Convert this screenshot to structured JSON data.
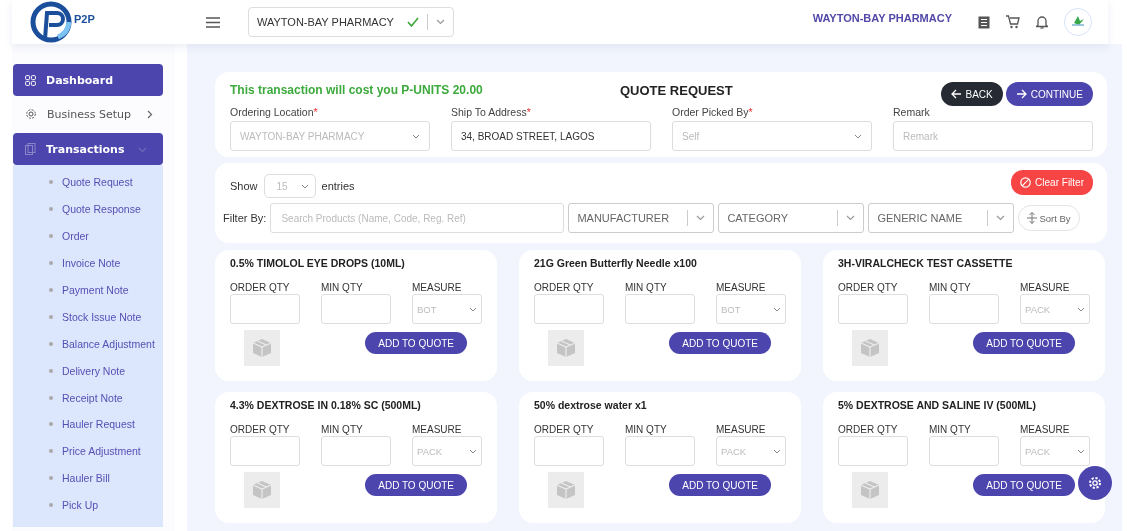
{
  "header": {
    "logo": "P2P",
    "location_select": {
      "value": "WAYTON-BAY PHARMACY",
      "valid": true
    },
    "organization": "WAYTON-BAY PHARMACY"
  },
  "sidebar": {
    "items": [
      {
        "label": "Dashboard",
        "kind": "link",
        "selected": true,
        "expanded": false
      },
      {
        "label": "Business Setup",
        "kind": "group",
        "selected": false,
        "expanded": false
      },
      {
        "label": "Transactions",
        "kind": "group",
        "selected": true,
        "expanded": true,
        "children": [
          {
            "label": "Quote Request",
            "selected": false
          },
          {
            "label": "Quote Response",
            "selected": false
          },
          {
            "label": "Order",
            "selected": false
          },
          {
            "label": "Invoice Note",
            "selected": false
          },
          {
            "label": "Payment Note",
            "selected": false
          },
          {
            "label": "Stock Issue Note",
            "selected": false
          },
          {
            "label": "Balance Adjustment",
            "selected": false
          },
          {
            "label": "Delivery Note",
            "selected": false
          },
          {
            "label": "Receipt Note",
            "selected": false
          },
          {
            "label": "Hauler Request",
            "selected": false
          },
          {
            "label": "Price Adjustment",
            "selected": false
          },
          {
            "label": "Hauler Bill",
            "selected": false
          },
          {
            "label": "Pick Up",
            "selected": false
          }
        ]
      }
    ]
  },
  "quote": {
    "cost_notice": "This transaction will cost you P-UNITS 20.00",
    "title": "QUOTE REQUEST",
    "back_button": "BACK",
    "continue_button": "CONTINUE",
    "fields": [
      {
        "label": "Ordering Location",
        "required_mark": "*",
        "kind": "select",
        "value": "WAYTON-BAY PHARMACY",
        "disabled": true
      },
      {
        "label": "Ship To Address",
        "required_mark": "*",
        "kind": "input",
        "value": "34, BROAD STREET, LAGOS"
      },
      {
        "label": "Order Picked By",
        "required_mark": "*",
        "kind": "select",
        "value": "Self",
        "disabled": true
      },
      {
        "label": "Remark",
        "kind": "input",
        "placeholder": "Remark"
      }
    ]
  },
  "filters": {
    "show_label": "Show",
    "page_size": "15",
    "entries_label": "entries",
    "clear_button": "Clear Filter",
    "filter_label": "Filter By:",
    "search_placeholder": "Search Products (Name, Code, Reg. Ref)",
    "dropdowns": [
      {
        "placeholder": "MANUFACTURER"
      },
      {
        "placeholder": "CATEGORY"
      },
      {
        "placeholder": "GENERIC NAME"
      }
    ],
    "sort_button": "Sort By"
  },
  "products": [
    {
      "name": "0.5% TIMOLOL EYE DROPS (10ML)",
      "order_qty_label": "ORDER QTY",
      "min_qty_label": "MIN QTY",
      "measure_label": "MEASURE",
      "measure": "BOT",
      "button": "ADD TO QUOTE"
    },
    {
      "name": "21G Green Butterfly Needle x100",
      "order_qty_label": "ORDER QTY",
      "min_qty_label": "MIN QTY",
      "measure_label": "MEASURE",
      "measure": "BOT",
      "button": "ADD TO QUOTE"
    },
    {
      "name": "3H-VIRALCHECK TEST CASSETTE",
      "order_qty_label": "ORDER QTY",
      "min_qty_label": "MIN QTY",
      "measure_label": "MEASURE",
      "measure": "PACK",
      "button": "ADD TO QUOTE"
    },
    {
      "name": "4.3% DEXTROSE IN 0.18% SC (500ML)",
      "order_qty_label": "ORDER QTY",
      "min_qty_label": "MIN QTY",
      "measure_label": "MEASURE",
      "measure": "PACK",
      "button": "ADD TO QUOTE"
    },
    {
      "name": "50% dextrose water x1",
      "order_qty_label": "ORDER QTY",
      "min_qty_label": "MIN QTY",
      "measure_label": "MEASURE",
      "measure": "PACK",
      "button": "ADD TO QUOTE"
    },
    {
      "name": "5% DEXTROSE AND SALINE IV (500ML)",
      "order_qty_label": "ORDER QTY",
      "min_qty_label": "MIN QTY",
      "measure_label": "MEASURE",
      "measure": "PACK",
      "button": "ADD TO QUOTE"
    }
  ]
}
